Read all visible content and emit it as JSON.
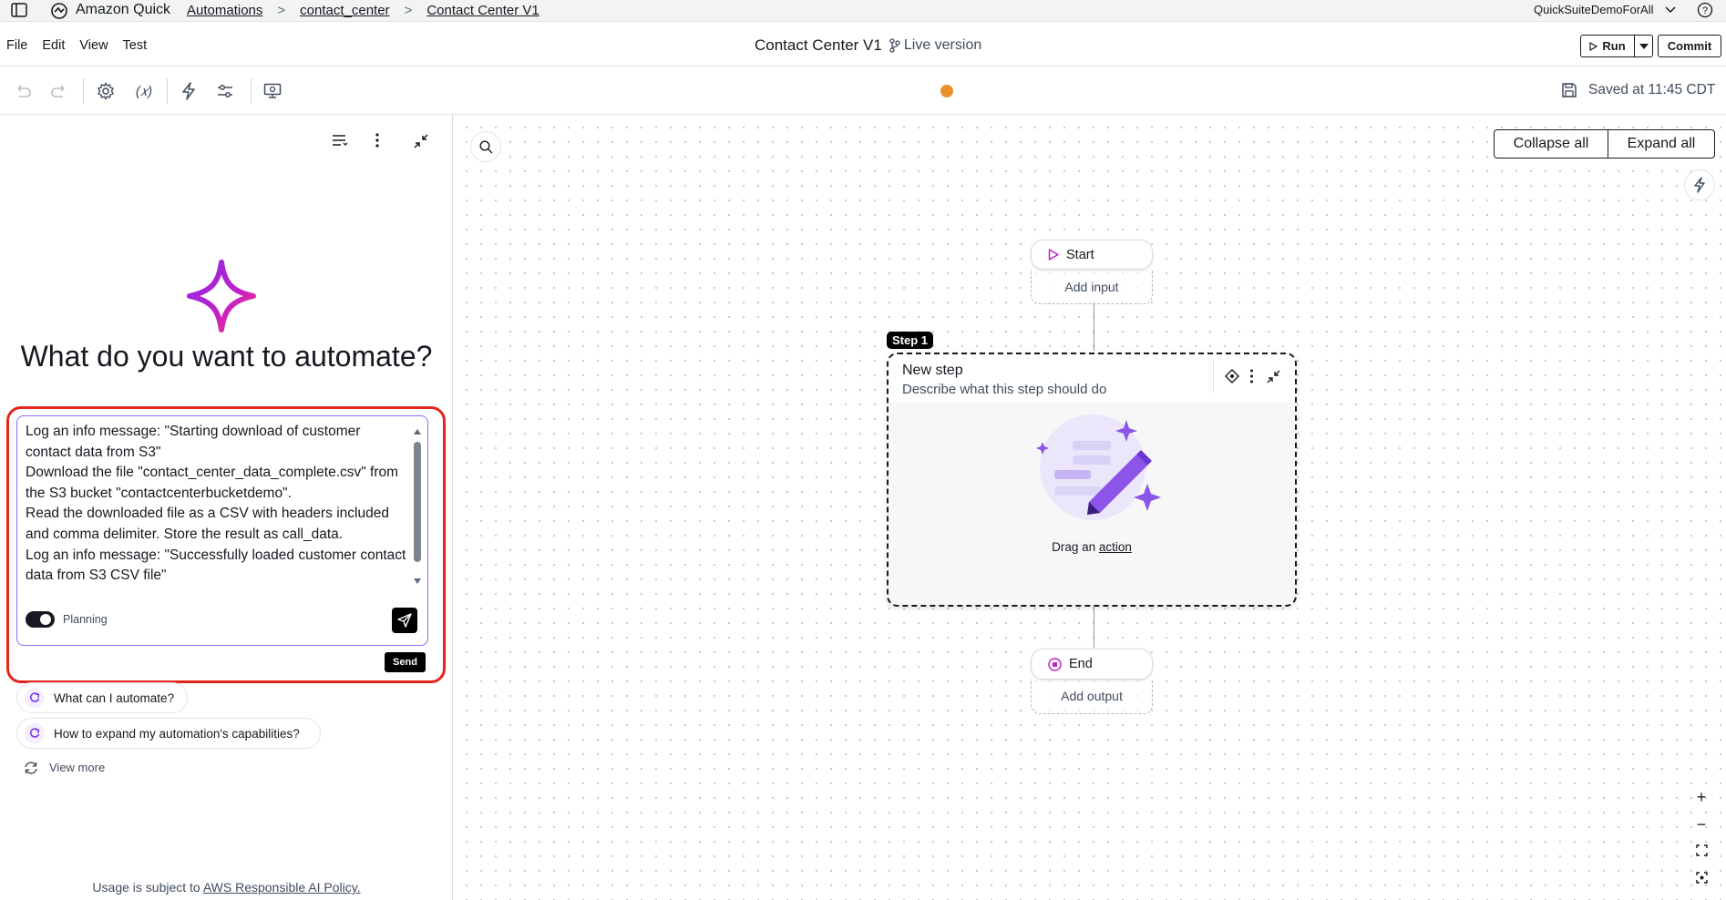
{
  "app": {
    "name": "Amazon Quick",
    "breadcrumbs": [
      "Automations",
      "contact_center",
      "Contact Center V1"
    ],
    "account": "QuickSuiteDemoForAll"
  },
  "menu": [
    "File",
    "Edit",
    "View",
    "Test"
  ],
  "document": {
    "title": "Contact Center V1",
    "version_label": "Live version"
  },
  "actions": {
    "run_label": "Run",
    "commit_label": "Commit"
  },
  "status": {
    "saved_text": "Saved at 11:45 CDT"
  },
  "assistant": {
    "heading": "What do you want to automate?",
    "input_value": "Log an info message: \"Starting download of customer contact data from S3\"\nDownload the file \"contact_center_data_complete.csv\" from the S3 bucket \"contactcenterbucketdemo\".\nRead the downloaded file as a CSV with headers included and comma delimiter. Store the result as call_data.\nLog an info message: \"Successfully loaded customer contact data from S3 CSV file\"",
    "planning_label": "Planning",
    "planning_on": true,
    "send_tooltip": "Send",
    "suggestions": [
      "What can I automate?",
      "How to expand my automation's capabilities?"
    ],
    "view_more": "View more",
    "footer_prefix": "Usage is subject to ",
    "footer_link": "AWS Responsible AI Policy."
  },
  "canvas": {
    "collapse_all": "Collapse all",
    "expand_all": "Expand all",
    "start": {
      "label": "Start",
      "sub": "Add input"
    },
    "step": {
      "badge": "Step 1",
      "title": "New step",
      "description": "Describe what this step should do",
      "drag_prefix": "Drag an ",
      "drag_link": "action"
    },
    "end": {
      "label": "End",
      "sub": "Add output"
    }
  },
  "colors": {
    "accent_purple": "#8d6bff",
    "highlight_red": "#e3261d",
    "status_dot": "#e8912d"
  }
}
